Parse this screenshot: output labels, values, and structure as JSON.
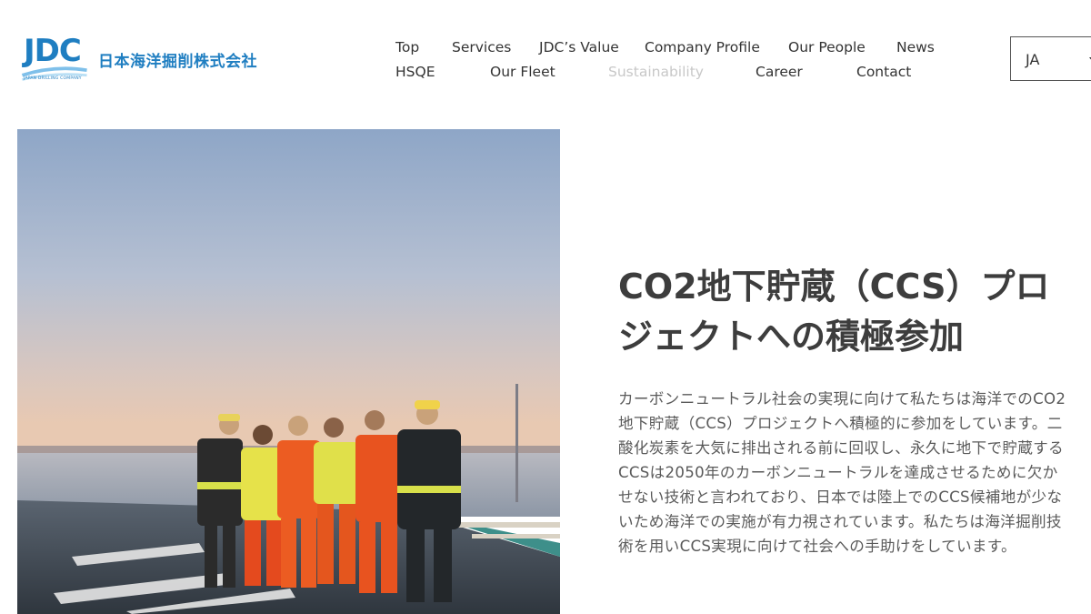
{
  "header": {
    "logo_text": "JDC",
    "logo_subtext": "JAPAN DRILLING COMPANY",
    "company_name": "日本海洋掘削株式会社",
    "brand_color": "#1f7ec1"
  },
  "nav": {
    "row1": [
      "Top",
      "Services",
      "JDC’s Value",
      "Company Profile",
      "Our People",
      "News"
    ],
    "row2": [
      "HSQE",
      "Our Fleet",
      "Sustainability",
      "Career",
      "Contact"
    ],
    "active_item": "Sustainability"
  },
  "language": {
    "selected": "JA"
  },
  "main": {
    "headline": "CO2地下貯蔵（CCS）プロジェクトへの積極参加",
    "body": "カーボンニュートラル社会の実現に向けて私たちは海洋でのCO2地下貯蔵（CCS）プロジェクトへ積極的に参加をしています。二酸化炭素を大気に排出される前に回収し、永久に地下で貯蔵するCCSは2050年のカーボンニュートラルを達成させるために欠かせない技術と言われており、日本では陸上でのCCS候補地が少ないため海洋での実施が有力視されています。私たちは海洋掘削技術を用いCCS実現に向けて社会への手助けをしています。"
  }
}
